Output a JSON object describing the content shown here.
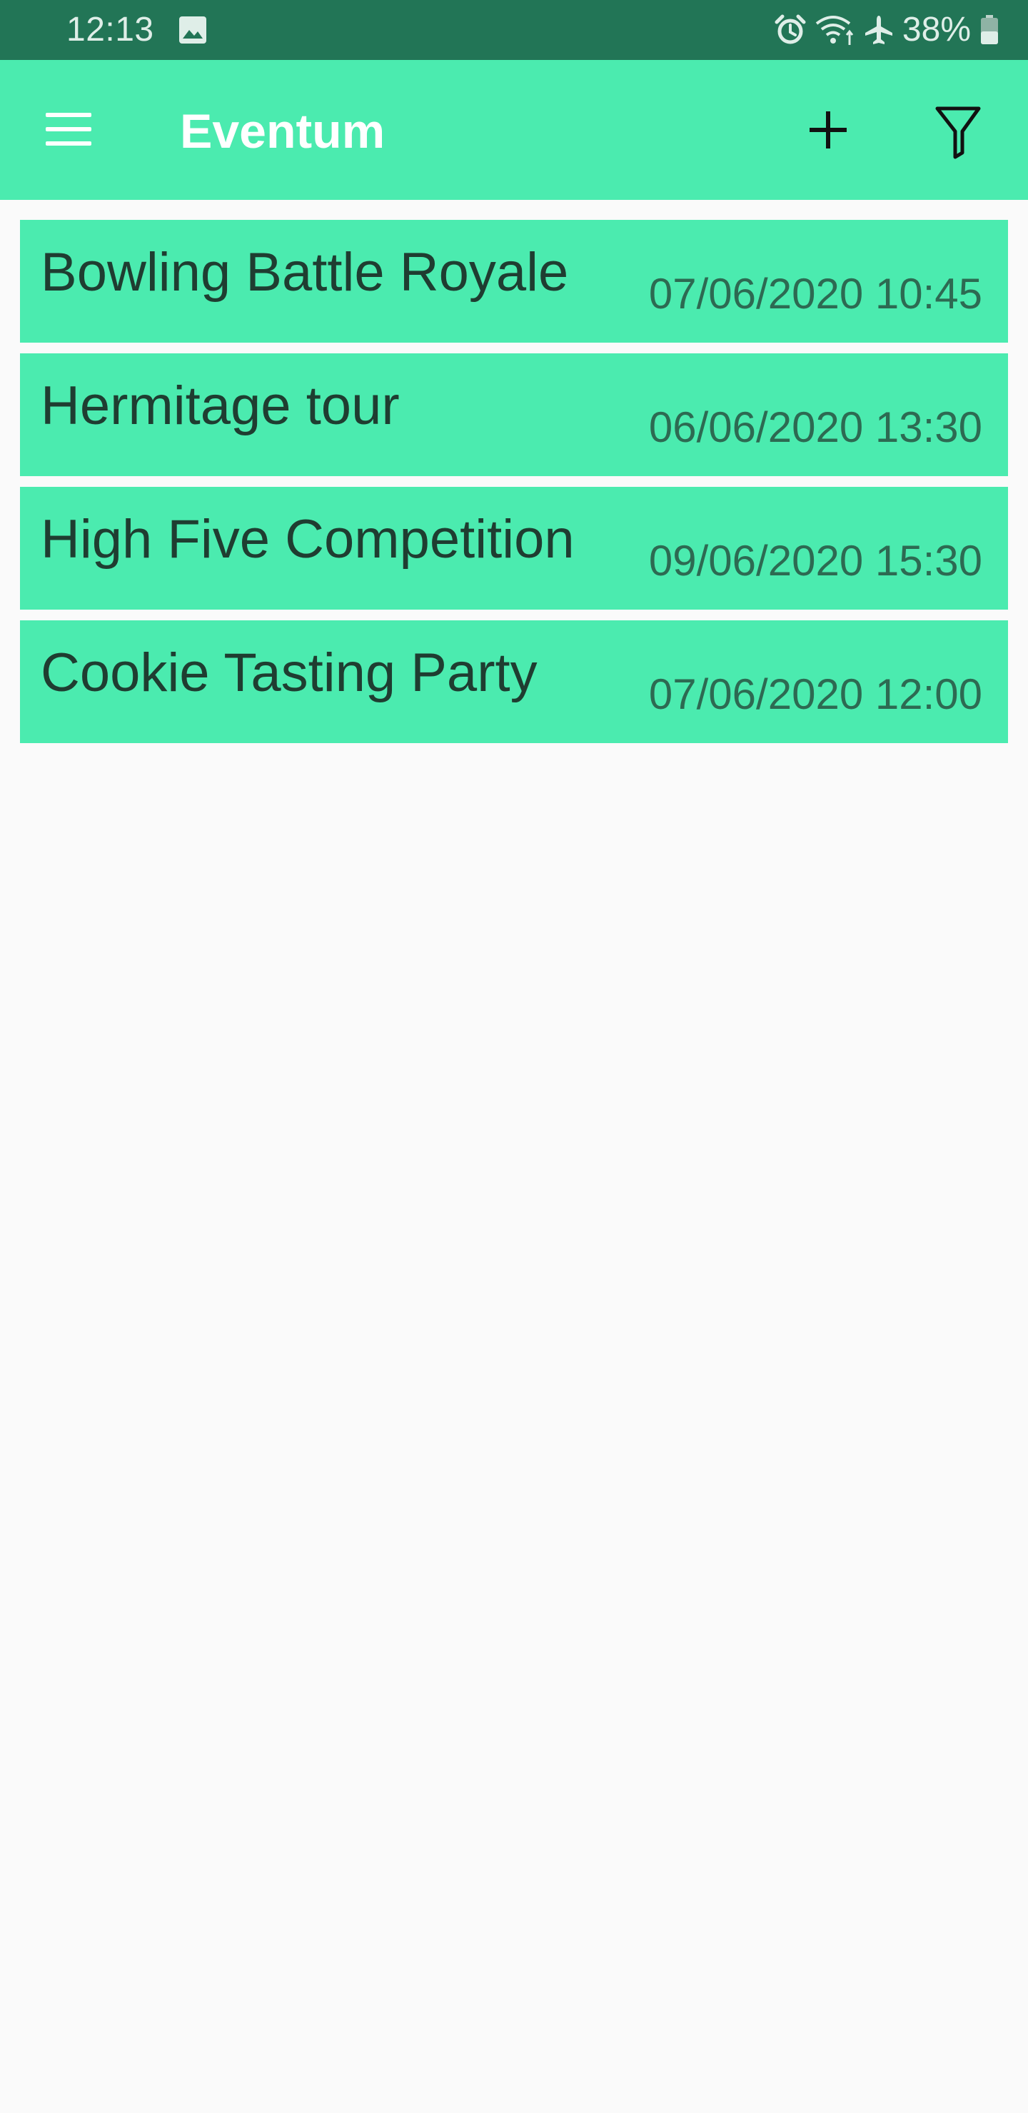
{
  "status_bar": {
    "time": "12:13",
    "battery": "38%",
    "icons": [
      "gallery-icon",
      "alarm-icon",
      "wifi-icon",
      "airplane-icon",
      "battery-icon"
    ]
  },
  "app_bar": {
    "title": "Eventum",
    "icons": [
      "menu-icon",
      "plus-icon",
      "filter-icon"
    ]
  },
  "events": [
    {
      "name": "Bowling Battle Royale",
      "datetime": "07/06/2020 10:45"
    },
    {
      "name": "Hermitage tour",
      "datetime": "06/06/2020 13:30"
    },
    {
      "name": "High Five Competition",
      "datetime": "09/06/2020 15:30"
    },
    {
      "name": "Cookie Tasting Party",
      "datetime": "07/06/2020 12:00"
    }
  ],
  "colors": {
    "status_bar": "#227556",
    "primary": "#4bebaf",
    "background": "#fafafa",
    "event_text": "#1f3d31",
    "date_text": "#2d6a52"
  }
}
